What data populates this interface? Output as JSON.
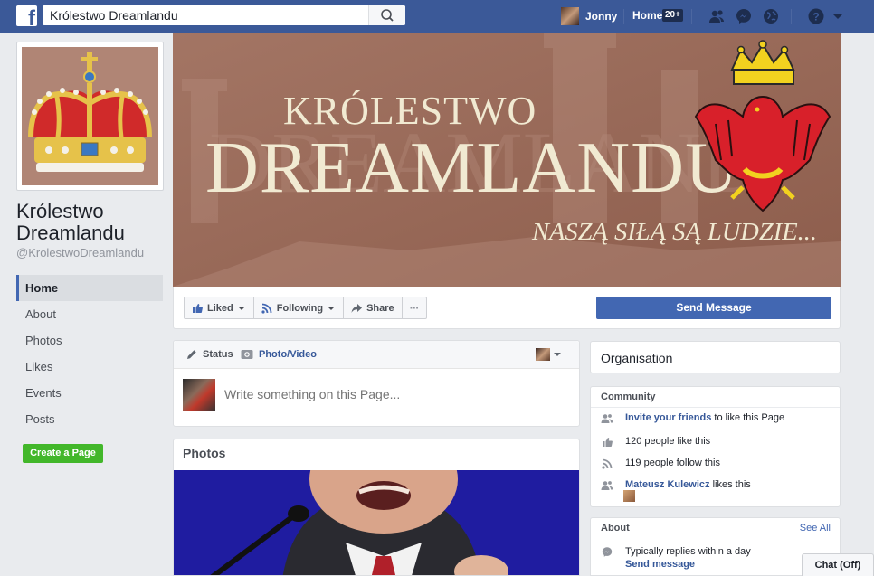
{
  "topbar": {
    "search_value": "Królestwo Dreamlandu",
    "user_name": "Jonny",
    "home_label": "Home",
    "home_badge": "20+"
  },
  "page": {
    "name": "Królestwo Dreamlandu",
    "handle": "@KrolestwoDreamlandu"
  },
  "left_nav": [
    {
      "label": "Home",
      "active": true
    },
    {
      "label": "About"
    },
    {
      "label": "Photos"
    },
    {
      "label": "Likes"
    },
    {
      "label": "Events"
    },
    {
      "label": "Posts"
    }
  ],
  "create_page_label": "Create a Page",
  "cover": {
    "line1": "KRÓLESTWO",
    "line2": "DREAMLANDU",
    "motto": "NASZĄ SIŁĄ SĄ LUDZIE..."
  },
  "actions": {
    "liked": "Liked",
    "following": "Following",
    "share": "Share",
    "more": "···",
    "send_message": "Send Message"
  },
  "composer": {
    "status": "Status",
    "photo_video": "Photo/Video",
    "placeholder": "Write something on this Page..."
  },
  "photos_title": "Photos",
  "right": {
    "organisation": "Organisation",
    "community_title": "Community",
    "invite_link": "Invite your friends",
    "invite_rest": " to like this Page",
    "likes": "120 people like this",
    "follows": "119 people follow this",
    "friend_name": "Mateusz Kulewicz",
    "friend_rest": " likes this",
    "about_title": "About",
    "see_all": "See All",
    "replies": "Typically replies within a day",
    "send_message_link": "Send message"
  },
  "chat_label": "Chat (Off)",
  "colors": {
    "fb_blue": "#3b5998",
    "button_blue": "#4267b2",
    "create_green": "#42b72a"
  }
}
